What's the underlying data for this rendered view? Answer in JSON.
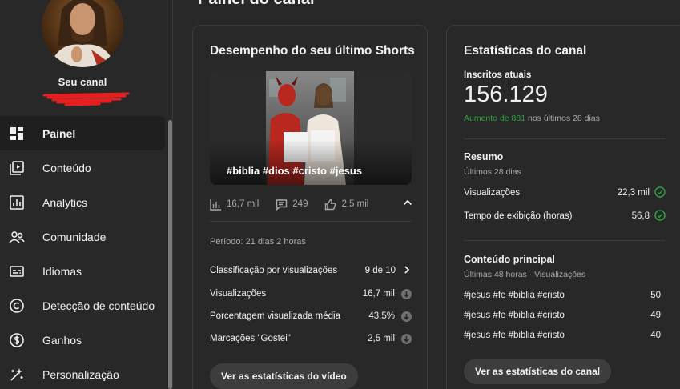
{
  "page": {
    "title": "Painel do canal"
  },
  "sidebar": {
    "channel_label": "Seu canal",
    "items": [
      {
        "label": "Painel",
        "icon": "dashboard-icon",
        "active": true
      },
      {
        "label": "Conteúdo",
        "icon": "content-icon"
      },
      {
        "label": "Analytics",
        "icon": "analytics-icon"
      },
      {
        "label": "Comunidade",
        "icon": "community-icon"
      },
      {
        "label": "Idiomas",
        "icon": "subtitles-icon"
      },
      {
        "label": "Detecção de conteúdo",
        "icon": "copyright-icon"
      },
      {
        "label": "Ganhos",
        "icon": "dollar-icon"
      },
      {
        "label": "Personalização",
        "icon": "magic-wand-icon"
      }
    ]
  },
  "shorts_card": {
    "title": "Desempenho do seu último Shorts",
    "thumbnail_caption": "#biblia #dios #cristo #jesus",
    "metrics": {
      "views": "16,7 mil",
      "comments": "249",
      "likes": "2,5 mil"
    },
    "period": "Período: 21 dias 2 horas",
    "rows": [
      {
        "label": "Classificação por visualizações",
        "value": "9 de 10"
      },
      {
        "label": "Visualizações",
        "value": "16,7 mil"
      },
      {
        "label": "Porcentagem visualizada média",
        "value": "43,5%"
      },
      {
        "label": "Marcações \"Gostei\"",
        "value": "2,5 mil"
      }
    ],
    "button": "Ver as estatísticas do vídeo"
  },
  "channel_card": {
    "title": "Estatísticas do canal",
    "subscribers_label": "Inscritos atuais",
    "subscribers": "156.129",
    "growth_highlight": "Aumento de 881",
    "growth_rest": "nos últimos 28 dias",
    "summary_title": "Resumo",
    "summary_sub": "Últimos 28 dias",
    "summary_rows": [
      {
        "label": "Visualizações",
        "value": "22,3 mil"
      },
      {
        "label": "Tempo de exibição (horas)",
        "value": "56,8"
      }
    ],
    "top_title": "Conteúdo principal",
    "top_sub": "Últimas 48 horas · Visualizações",
    "top_rows": [
      {
        "label": "#jesus #fe #biblia #cristo",
        "value": "50"
      },
      {
        "label": "#jesus #fe #biblia #cristo",
        "value": "49"
      },
      {
        "label": "#jesus #fe #biblia #cristo",
        "value": "40"
      }
    ],
    "button": "Ver as estatísticas do canal"
  },
  "colors": {
    "accent_green": "#2ba640",
    "background": "#282828",
    "red_scribble": "#e52020"
  }
}
